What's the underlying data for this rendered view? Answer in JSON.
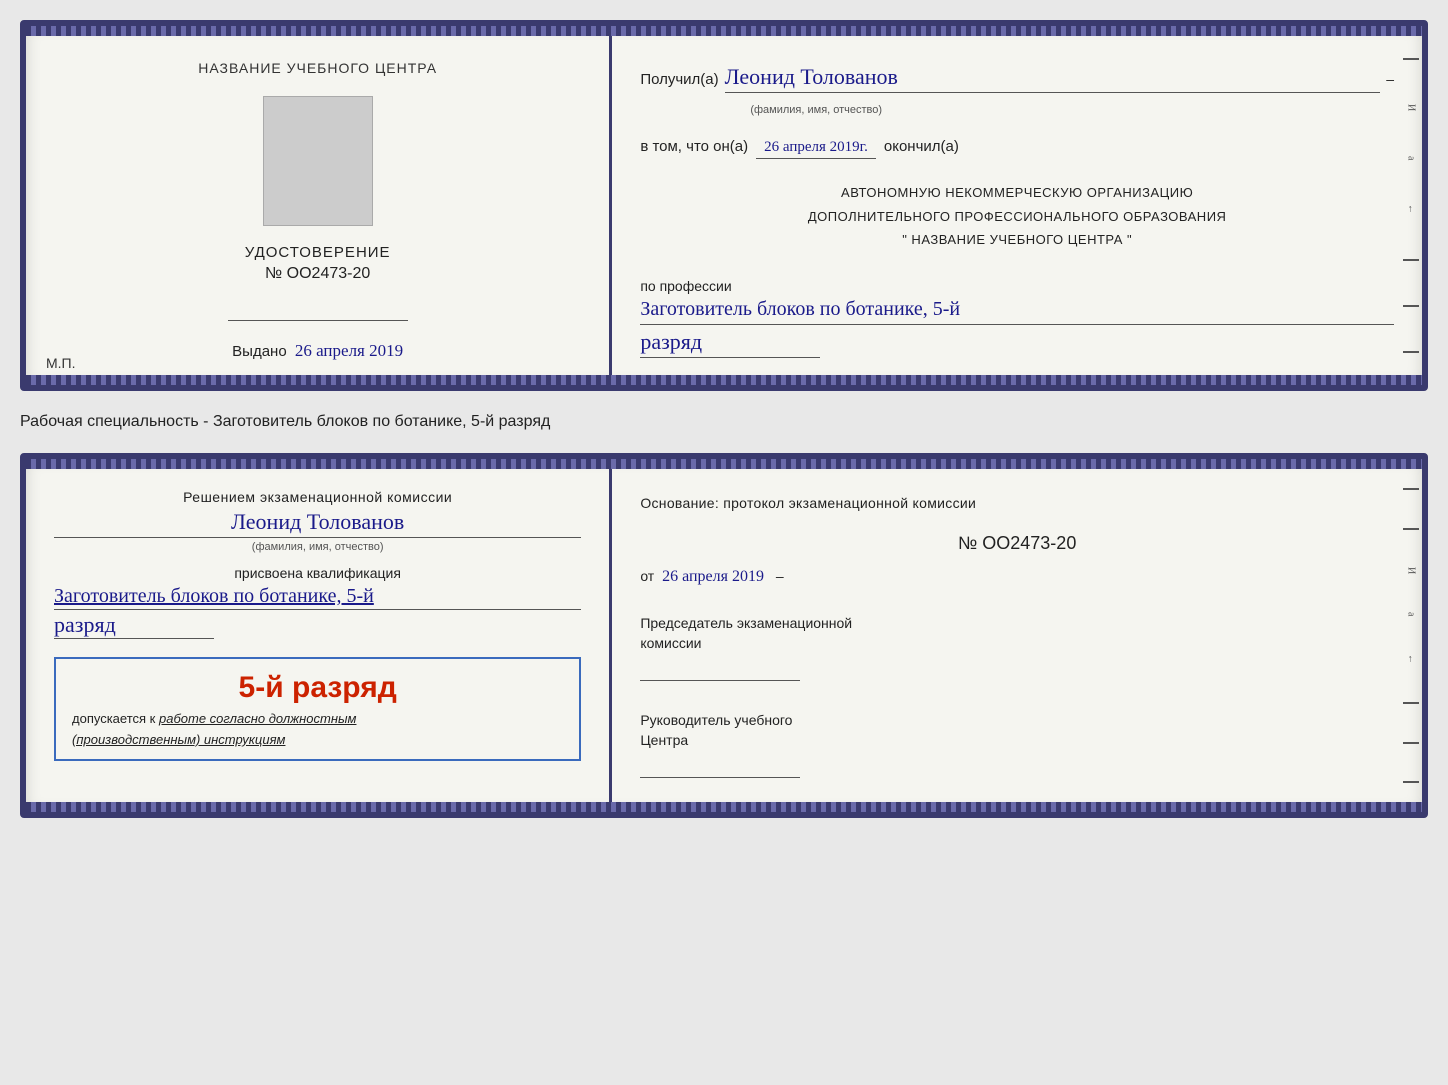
{
  "doc1": {
    "left": {
      "center_label": "НАЗВАНИЕ УЧЕБНОГО ЦЕНТРА",
      "udostoverenie_title": "УДОСТОВЕРЕНИЕ",
      "doc_number": "№ OO2473-20",
      "vydano_label": "Выдано",
      "vydano_date": "26 апреля 2019",
      "mp_label": "М.П."
    },
    "right": {
      "poluchil_prefix": "Получил(а)",
      "recipient_name": "Леонид Толованов",
      "fio_sublabel": "(фамилия, имя, отчество)",
      "vtom_prefix": "в том, что он(а)",
      "completion_date": "26 апреля 2019г.",
      "okonchil": "окончил(а)",
      "org_line1": "АВТОНОМНУЮ НЕКОММЕРЧЕСКУЮ ОРГАНИЗАЦИЮ",
      "org_line2": "ДОПОЛНИТЕЛЬНОГО ПРОФЕССИОНАЛЬНОГО ОБРАЗОВАНИЯ",
      "org_line3": "\"   НАЗВАНИЕ УЧЕБНОГО ЦЕНТРА   \"",
      "po_professii": "по профессии",
      "profession": "Заготовитель блоков по ботанике, 5-й",
      "razryad": "разряд"
    }
  },
  "specialty_label": "Рабочая специальность - Заготовитель блоков по ботанике, 5-й разряд",
  "doc2": {
    "left": {
      "resheniem": "Решением экзаменационной комиссии",
      "recipient_name": "Леонид Толованов",
      "fio_sublabel": "(фамилия, имя, отчество)",
      "prisvoena": "присвоена квалификация",
      "profession": "Заготовитель блоков по ботанике, 5-й",
      "razryad": "разряд",
      "stamp_number": "5-й разряд",
      "dopuskaetsya_prefix": "допускается к",
      "dopuskaetsya_text": "работе согласно должностным",
      "dopuskaetsya_suffix": "(производственным) инструкциям"
    },
    "right": {
      "osnovanie": "Основание: протокол экзаменационной  комиссии",
      "protocol_number": "№  OO2473-20",
      "ot_label": "от",
      "ot_date": "26 апреля 2019",
      "predsedatel_title": "Председатель экзаменационной",
      "predsedatel_subtitle": "комиссии",
      "rukovoditel_title": "Руководитель учебного",
      "rukovoditel_subtitle": "Центра"
    }
  }
}
